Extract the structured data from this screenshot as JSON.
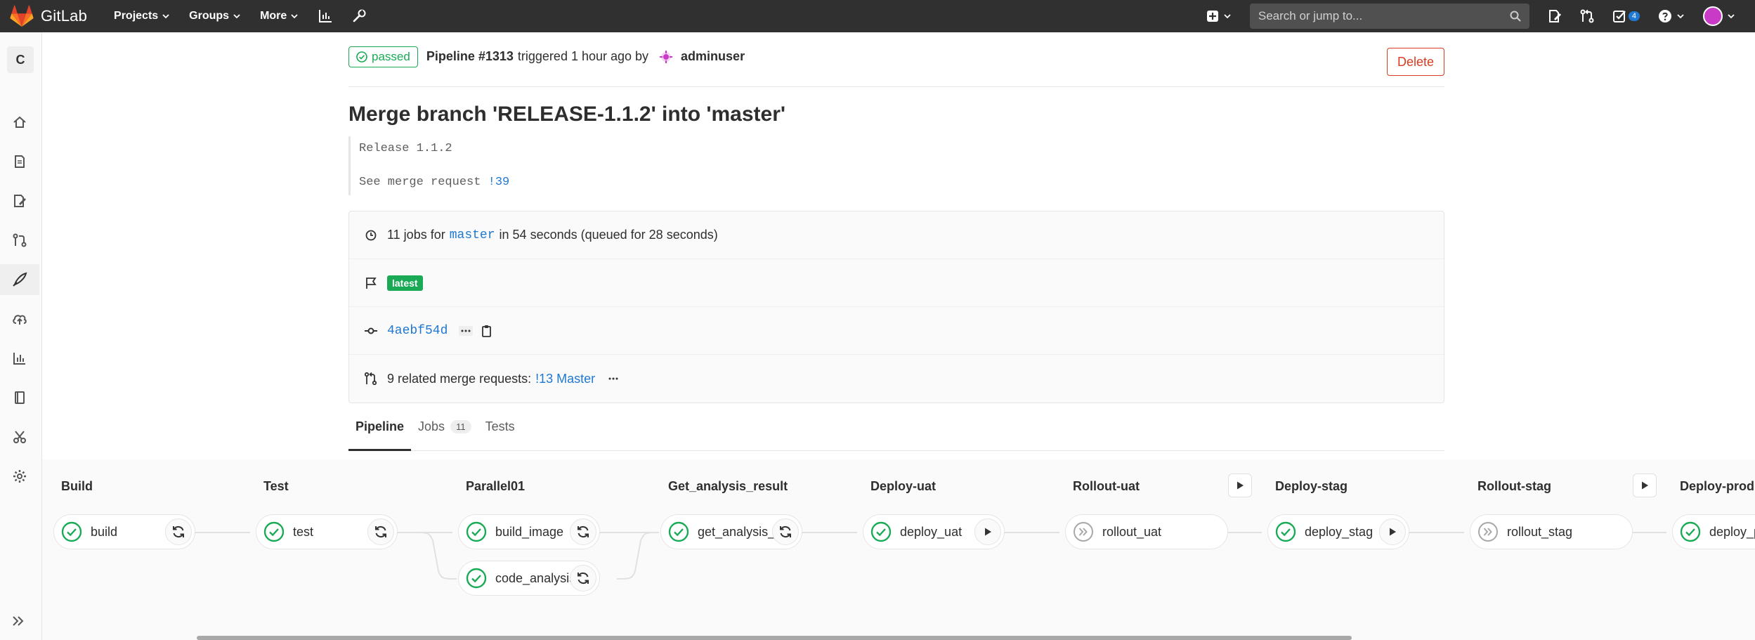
{
  "navbar": {
    "brand": "GitLab",
    "menu": [
      {
        "label": "Projects"
      },
      {
        "label": "Groups"
      },
      {
        "label": "More"
      }
    ],
    "search_placeholder": "Search or jump to...",
    "todo_count": "4"
  },
  "sidebar": {
    "project_initial": "C"
  },
  "pipeline": {
    "status": "passed",
    "id_label": "Pipeline #1313",
    "triggered_text": "triggered 1 hour ago by",
    "user": "adminuser",
    "delete_label": "Delete",
    "title": "Merge branch 'RELEASE-1.1.2' into 'master'",
    "description_line1": "Release 1.1.2",
    "description_line2": "See merge request",
    "description_mr": "!39",
    "jobs_summary_pre": "11 jobs for",
    "branch": "master",
    "jobs_summary_post": "in 54 seconds (queued for 28 seconds)",
    "latest_badge": "latest",
    "commit_sha": "4aebf54d",
    "related_pre": "9 related merge requests:",
    "related_link": "!13 Master"
  },
  "tabs": [
    {
      "label": "Pipeline"
    },
    {
      "label": "Jobs",
      "count": "11"
    },
    {
      "label": "Tests"
    }
  ],
  "stages": [
    {
      "title": "Build",
      "jobs": [
        {
          "name": "build",
          "status": "success",
          "action": "retry"
        }
      ]
    },
    {
      "title": "Test",
      "jobs": [
        {
          "name": "test",
          "status": "success",
          "action": "retry"
        }
      ]
    },
    {
      "title": "Parallel01",
      "jobs": [
        {
          "name": "build_image",
          "status": "success",
          "action": "retry"
        },
        {
          "name": "code_analysis",
          "status": "success",
          "action": "retry"
        }
      ]
    },
    {
      "title": "Get_analysis_result",
      "jobs": [
        {
          "name": "get_analysis_re...",
          "status": "success",
          "action": "retry"
        }
      ]
    },
    {
      "title": "Deploy-uat",
      "jobs": [
        {
          "name": "deploy_uat",
          "status": "success",
          "action": "play"
        }
      ]
    },
    {
      "title": "Rollout-uat",
      "stage_action": "play",
      "jobs": [
        {
          "name": "rollout_uat",
          "status": "skipped",
          "action": ""
        }
      ]
    },
    {
      "title": "Deploy-stag",
      "jobs": [
        {
          "name": "deploy_stag",
          "status": "success",
          "action": "play"
        }
      ]
    },
    {
      "title": "Rollout-stag",
      "stage_action": "play",
      "jobs": [
        {
          "name": "rollout_stag",
          "status": "skipped",
          "action": ""
        }
      ]
    },
    {
      "title": "Deploy-prod",
      "jobs": [
        {
          "name": "deploy_prod",
          "status": "success",
          "action": ""
        }
      ]
    }
  ]
}
